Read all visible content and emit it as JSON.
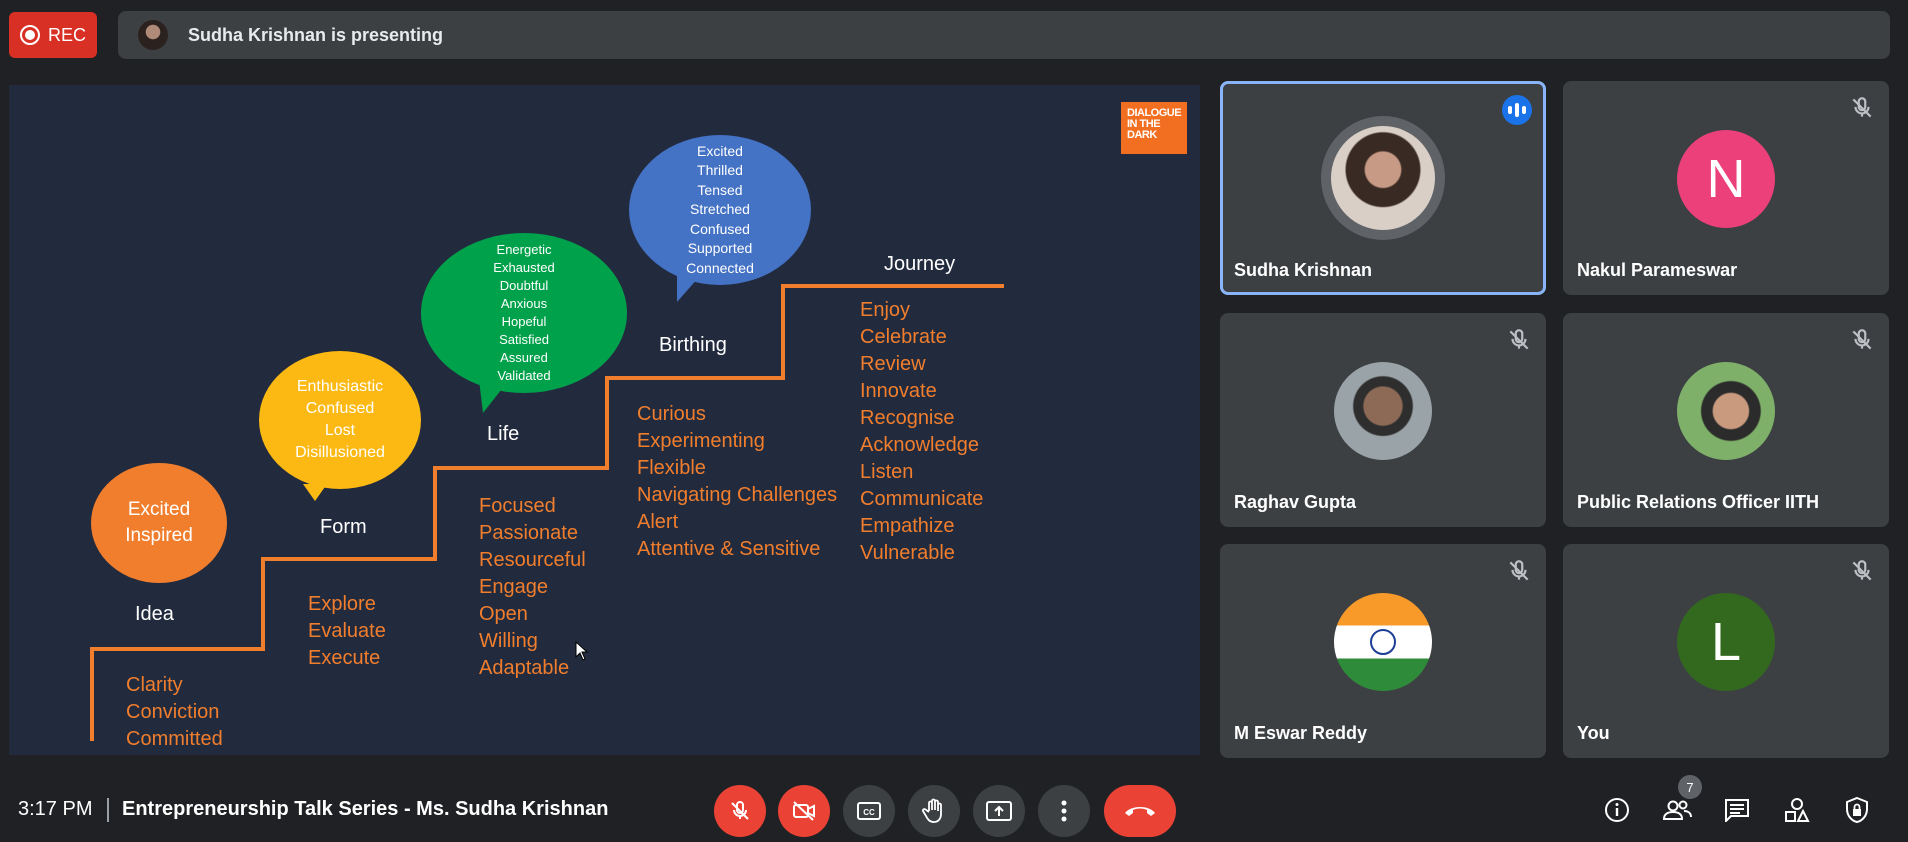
{
  "recording": {
    "label": "REC"
  },
  "presenting_banner": {
    "text": "Sudha Krishnan is presenting"
  },
  "slide": {
    "logo": {
      "line1": "DIALOGUE",
      "line2": "IN THE",
      "line3": "DARK"
    },
    "stages": [
      {
        "title": "Idea",
        "bubble": [
          "Excited",
          "Inspired"
        ],
        "bubble_color": "#f07e2d",
        "items": [
          "Clarity",
          "Conviction",
          "Committed"
        ]
      },
      {
        "title": "Form",
        "bubble": [
          "Enthusiastic",
          "Confused",
          "Lost",
          "Disillusioned"
        ],
        "bubble_color": "#fdb913",
        "items": [
          "Explore",
          "Evaluate",
          "Execute"
        ]
      },
      {
        "title": "Life",
        "bubble": [
          "Energetic",
          "Exhausted",
          "Doubtful",
          "Anxious",
          "Hopeful",
          "Satisfied",
          "Assured",
          "Validated"
        ],
        "bubble_color": "#00a14b",
        "items": [
          "Focused",
          "Passionate",
          "Resourceful",
          "Engage",
          "Open",
          "Willing",
          "Adaptable"
        ]
      },
      {
        "title": "Birthing",
        "bubble": [
          "Excited",
          "Thrilled",
          "Tensed",
          "Stretched",
          "Confused",
          "Supported",
          "Connected"
        ],
        "bubble_color": "#4472c4",
        "items": [
          "Curious",
          "Experimenting",
          "Flexible",
          "Navigating Challenges",
          "Alert",
          "Attentive & Sensitive"
        ]
      },
      {
        "title": "Journey",
        "items": [
          "Enjoy",
          "Celebrate",
          "Review",
          "Innovate",
          "Recognise",
          "Acknowledge",
          "Listen",
          "Communicate",
          "Empathize",
          "Vulnerable"
        ]
      }
    ]
  },
  "participants": [
    {
      "name": "Sudha Krishnan",
      "type": "photo",
      "speaking": true,
      "muted": false
    },
    {
      "name": "Nakul Parameswar",
      "type": "letter",
      "letter": "N",
      "color": "#ec407a",
      "muted": true
    },
    {
      "name": "Raghav Gupta",
      "type": "photo",
      "muted": true
    },
    {
      "name": "Public Relations Officer IITH",
      "type": "photo",
      "muted": true
    },
    {
      "name": "M Eswar Reddy",
      "type": "flag",
      "muted": true
    },
    {
      "name": "You",
      "type": "letter",
      "letter": "L",
      "color": "#33691e",
      "muted": true
    }
  ],
  "bottom_bar": {
    "time": "3:17 PM",
    "meeting_title": "Entrepreneurship Talk Series - Ms. Sudha Krishnan",
    "people_count": "7",
    "controls": [
      "mic-off",
      "camera-off",
      "captions",
      "raise-hand",
      "present",
      "more-options",
      "end-call"
    ],
    "right_controls": [
      "meeting-details",
      "people",
      "chat",
      "activities",
      "host-controls"
    ]
  }
}
